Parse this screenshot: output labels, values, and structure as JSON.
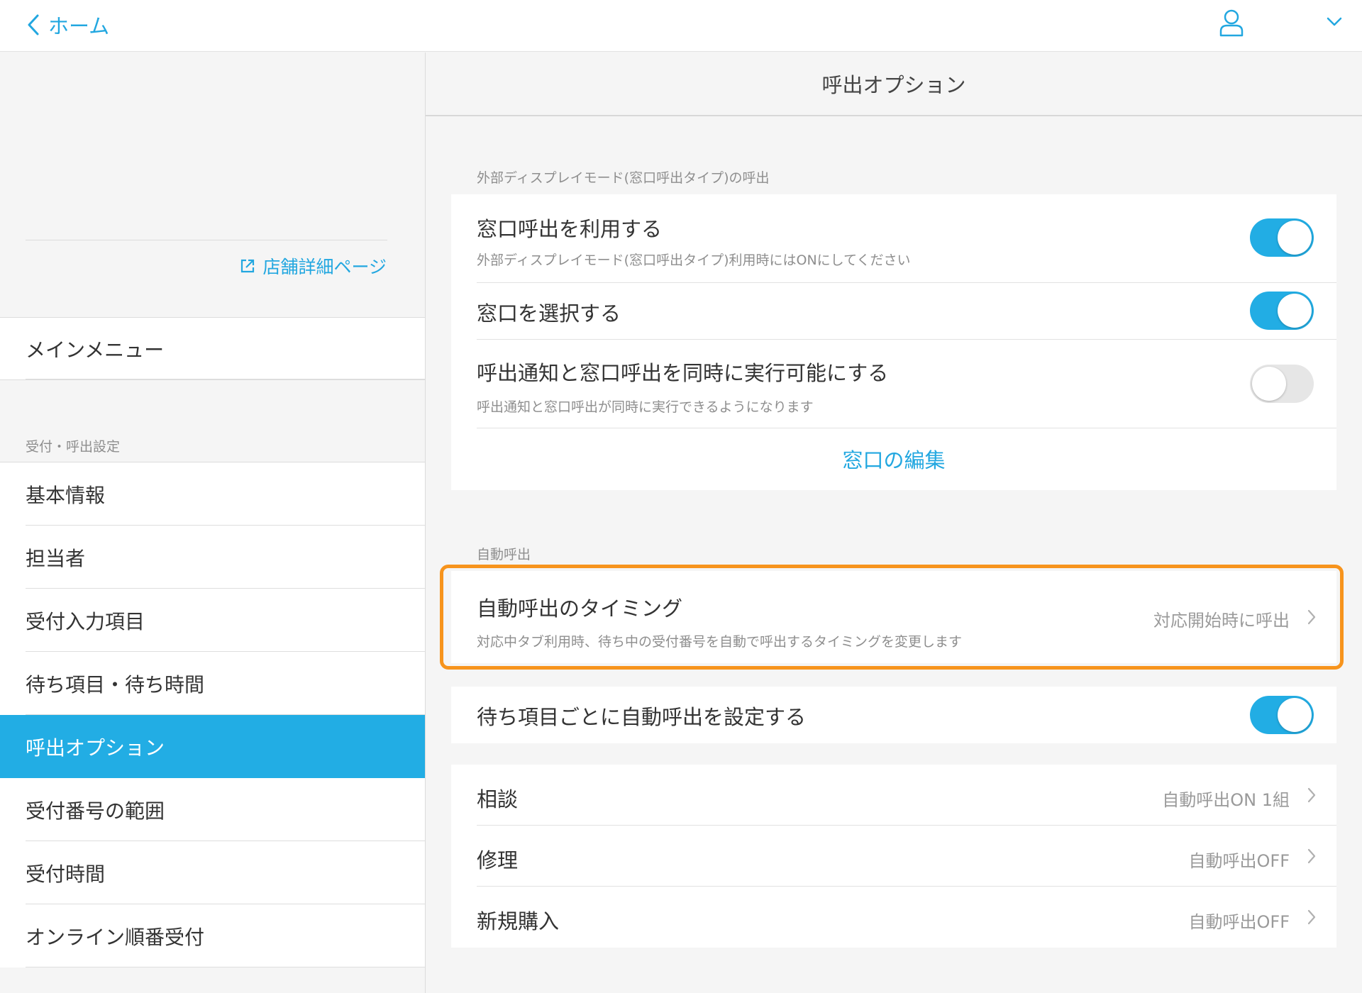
{
  "topbar": {
    "back_label": "ホーム"
  },
  "sidebar": {
    "store_link": "店舗詳細ページ",
    "main_menu": "メインメニュー",
    "section_label": "受付・呼出設定",
    "items": [
      {
        "label": "基本情報"
      },
      {
        "label": "担当者"
      },
      {
        "label": "受付入力項目"
      },
      {
        "label": "待ち項目・待ち時間"
      },
      {
        "label": "呼出オプション",
        "active": true
      },
      {
        "label": "受付番号の範囲"
      },
      {
        "label": "受付時間"
      },
      {
        "label": "オンライン順番受付"
      }
    ]
  },
  "main": {
    "title": "呼出オプション",
    "external_section": {
      "label": "外部ディスプレイモード(窓口呼出タイプ)の呼出",
      "rows": [
        {
          "title": "窓口呼出を利用する",
          "subtitle": "外部ディスプレイモード(窓口呼出タイプ)利用時にはONにしてください",
          "toggle": true
        },
        {
          "title": "窓口を選択する",
          "toggle": true
        },
        {
          "title": "呼出通知と窓口呼出を同時に実行可能にする",
          "subtitle": "呼出通知と窓口呼出が同時に実行できるようになります",
          "toggle": false
        }
      ],
      "edit_link": "窓口の編集"
    },
    "auto_section": {
      "label": "自動呼出",
      "timing": {
        "title": "自動呼出のタイミング",
        "subtitle": "対応中タブ利用時、待ち中の受付番号を自動で呼出するタイミングを変更します",
        "value": "対応開始時に呼出"
      },
      "per_item": {
        "title": "待ち項目ごとに自動呼出を設定する",
        "toggle": true
      },
      "items": [
        {
          "title": "相談",
          "value": "自動呼出ON 1組"
        },
        {
          "title": "修理",
          "value": "自動呼出OFF"
        },
        {
          "title": "新規購入",
          "value": "自動呼出OFF"
        }
      ]
    }
  },
  "colors": {
    "accent": "#22ade4",
    "highlight": "#f7941d"
  }
}
